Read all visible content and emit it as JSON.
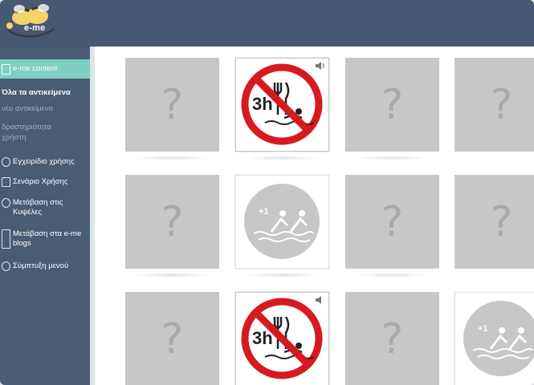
{
  "header": {
    "logo_text": "e-me"
  },
  "sidebar": {
    "active_item": "e-me content",
    "section_title": "Όλα τα αντικείμενα",
    "sub_items": [
      "νέο αντικείμενο",
      "δραστηριότητα",
      "χρήστη"
    ],
    "items": [
      {
        "label": "Εγχειρίδιο χρήσης",
        "icon": "info-icon"
      },
      {
        "label": "Σενάριο Χρήσης",
        "icon": "document-icon"
      },
      {
        "label": "Μετάβαση στις Κυψέλες",
        "icon": "hive-icon"
      },
      {
        "label": "Μετάβαση στα e-me blogs",
        "icon": "blog-icon"
      },
      {
        "label": "Σύμπτυξη μενού",
        "icon": "collapse-icon"
      }
    ]
  },
  "game": {
    "back_symbol": "?",
    "no_eating_label": "3h",
    "swim_label": "+1",
    "cards": [
      {
        "state": "hidden"
      },
      {
        "state": "revealed",
        "image": "no-eating-swim-3h",
        "speaker": true
      },
      {
        "state": "hidden"
      },
      {
        "state": "hidden"
      },
      {
        "state": "hidden"
      },
      {
        "state": "matched",
        "image": "swim-plus-one"
      },
      {
        "state": "hidden"
      },
      {
        "state": "hidden"
      },
      {
        "state": "hidden"
      },
      {
        "state": "revealed",
        "image": "no-eating-swim-3h",
        "speaker": true
      },
      {
        "state": "hidden"
      },
      {
        "state": "matched",
        "image": "swim-plus-one"
      }
    ]
  },
  "colors": {
    "topbar": "#465873",
    "sidebar": "#4a5b74",
    "accent": "#7fcfc2",
    "card_back": "#c7c7c7",
    "prohibition_red": "#d71920"
  }
}
